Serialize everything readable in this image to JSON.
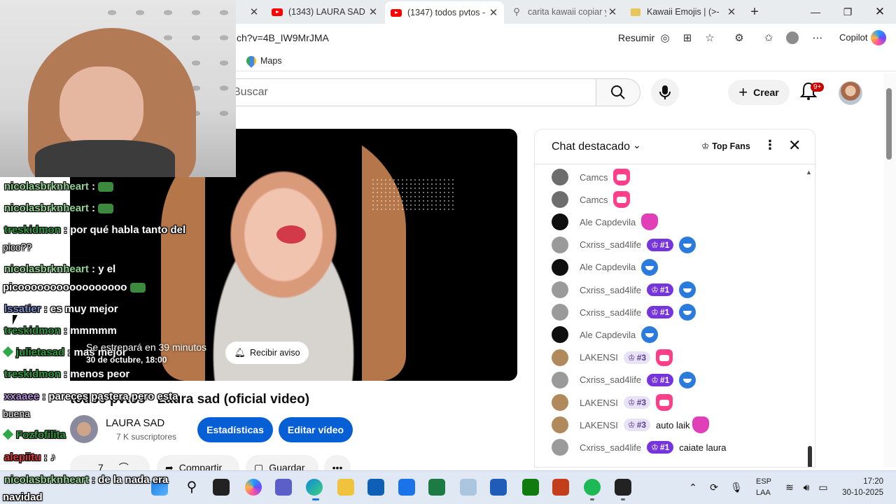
{
  "browser": {
    "tabs": [
      {
        "title": "(1343) LAURA SAD -",
        "icon": "youtube-icon"
      },
      {
        "title": "(1347) todos pvtos -",
        "icon": "youtube-icon"
      },
      {
        "title": "carita kawaii copiar y",
        "icon": "search-icon"
      },
      {
        "title": "Kawaii Emojis | (>-",
        "icon": "folder-icon"
      }
    ],
    "url": "ch?v=4B_IW9MrJMA",
    "resumir": "Resumir",
    "copilot": "Copilot",
    "favorites": [
      {
        "label": "Maps",
        "icon": "maps-pin-icon"
      }
    ]
  },
  "youtube": {
    "search_placeholder": "Buscar",
    "create_label": "Crear",
    "notifications_badge": "9+"
  },
  "video": {
    "premiere_text": "Se estrenará en 39 minutos",
    "premiere_date": "30 de octubre, 18:00",
    "notify_label": "Recibir aviso",
    "title": "todos pvtos - Laura sad (oficial video)",
    "channel": "LAURA SAD",
    "subscribers": "7 K suscriptores",
    "stats_button": "Estadísticas",
    "edit_button": "Editar vídeo",
    "likes": "7",
    "share_label": "Compartir",
    "save_label": "Guardar"
  },
  "chat": {
    "title": "Chat destacado",
    "top_fans_label": "Top Fans",
    "messages": [
      {
        "name": "Camcs",
        "badge": "",
        "text": "",
        "avatar": "#6d6d6d",
        "emoji": "pink"
      },
      {
        "name": "Camcs",
        "badge": "",
        "text": "",
        "avatar": "#6d6d6d",
        "emoji": "pink"
      },
      {
        "name": "Ale Capdevila",
        "badge": "",
        "text": "",
        "avatar": "#0f0f0f",
        "emoji": "wave"
      },
      {
        "name": "Cxriss_sad4life",
        "badge": "#1",
        "text": "",
        "avatar": "#9a9a9a",
        "emoji": "blue"
      },
      {
        "name": "Ale Capdevila",
        "badge": "",
        "text": "",
        "avatar": "#0f0f0f",
        "emoji": "blue"
      },
      {
        "name": "Cxriss_sad4life",
        "badge": "#1",
        "text": "",
        "avatar": "#9a9a9a",
        "emoji": "blue"
      },
      {
        "name": "Cxriss_sad4life",
        "badge": "#1",
        "text": "",
        "avatar": "#9a9a9a",
        "emoji": "blue"
      },
      {
        "name": "Ale Capdevila",
        "badge": "",
        "text": "",
        "avatar": "#0f0f0f",
        "emoji": "blue"
      },
      {
        "name": "LAKENSI",
        "badge": "#3",
        "text": "",
        "avatar": "#b08a5a",
        "emoji": "pink"
      },
      {
        "name": "Cxriss_sad4life",
        "badge": "#1",
        "text": "",
        "avatar": "#9a9a9a",
        "emoji": "blue"
      },
      {
        "name": "LAKENSI",
        "badge": "#3",
        "text": "",
        "avatar": "#b08a5a",
        "emoji": "pink"
      },
      {
        "name": "LAKENSI",
        "badge": "#3",
        "text": "auto laik",
        "avatar": "#b08a5a",
        "emoji": ""
      },
      {
        "name": "Cxriss_sad4life",
        "badge": "#1",
        "text": "caiate laura",
        "avatar": "#9a9a9a",
        "emoji": ""
      }
    ]
  },
  "overlay_chat": [
    {
      "user": "nicolasbrknheart",
      "text": " : ",
      "color": "light",
      "emote": true
    },
    {
      "user": "nicolasbrknheart",
      "text": " : ",
      "color": "light",
      "emote": true
    },
    {
      "user": "treskidmon",
      "text": " : por qué habla tanto del",
      "color": "green"
    },
    {
      "user": "",
      "text": "pico??",
      "color": ""
    },
    {
      "user": "nicolasbrknheart",
      "text": " : y el",
      "color": "light"
    },
    {
      "user": "",
      "text": "picooooooooooooooooo",
      "color": ""
    },
    {
      "user": "lssatier",
      "text": " : es muy mejor",
      "color": "blue"
    },
    {
      "user": "treskidmon",
      "text": " : mmmmm",
      "color": "green"
    },
    {
      "user": "julietasad",
      "text": " : mas mejor",
      "color": "green"
    },
    {
      "user": "treskidmon",
      "text": " : menos peor",
      "color": "green"
    },
    {
      "user": "xxaaee",
      "text": " : pareces pastera pero esta",
      "color": "purple"
    },
    {
      "user": "",
      "text": "buena",
      "color": ""
    },
    {
      "user": "Fozfofilita",
      "text": "",
      "color": "green"
    },
    {
      "user": "alepiitu",
      "text": " : ♪",
      "color": "red"
    },
    {
      "user": "nicolasbrknheart",
      "text": " : de la nada era",
      "color": "light"
    },
    {
      "user": "",
      "text": "navidad",
      "color": ""
    }
  ],
  "taskbar": {
    "lang_line1": "ESP",
    "lang_line2": "LAA",
    "time": "17:20",
    "date": "30-10-2025"
  }
}
